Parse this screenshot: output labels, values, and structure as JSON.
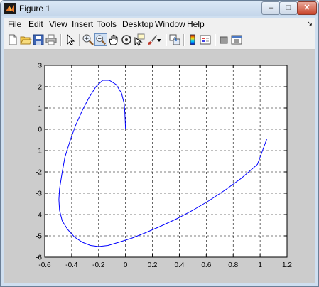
{
  "window": {
    "title": "Figure 1",
    "close_glyph": "✕",
    "minimize_glyph": "–",
    "maximize_glyph": "□"
  },
  "menu": {
    "items": [
      {
        "label": "File",
        "key": "F",
        "rest": "ile"
      },
      {
        "label": "Edit",
        "key": "E",
        "rest": "dit"
      },
      {
        "label": "View",
        "key": "V",
        "rest": "iew"
      },
      {
        "label": "Insert",
        "key": "I",
        "rest": "nsert"
      },
      {
        "label": "Tools",
        "key": "T",
        "rest": "ools"
      },
      {
        "label": "Desktop",
        "key": "D",
        "rest": "esktop"
      },
      {
        "label": "Window",
        "key": "W",
        "rest": "indow"
      },
      {
        "label": "Help",
        "key": "H",
        "rest": "elp"
      }
    ],
    "dock_glyph": "↘"
  },
  "toolbar": {
    "buttons": [
      "new-figure",
      "open-file",
      "save-figure",
      "print-figure",
      "edit-plot",
      "zoom-in",
      "zoom-out",
      "pan",
      "rotate-3d",
      "data-cursor",
      "brush",
      "link-plot",
      "insert-colorbar",
      "insert-legend",
      "hide-plot-tools",
      "show-plot-tools"
    ],
    "active": "zoom-out"
  },
  "colors": {
    "line": "#0000ff",
    "axes_bg": "#ffffff",
    "figure_bg": "#cccccc"
  },
  "chart_data": {
    "type": "line",
    "title": "",
    "xlabel": "",
    "ylabel": "",
    "xlim": [
      -0.6,
      1.2
    ],
    "ylim": [
      -6,
      3
    ],
    "xticks": [
      -0.6,
      -0.4,
      -0.2,
      0,
      0.2,
      0.4,
      0.6,
      0.8,
      1,
      1.2
    ],
    "yticks": [
      -6,
      -5,
      -4,
      -3,
      -2,
      -1,
      0,
      1,
      2,
      3
    ],
    "xtick_labels": [
      "-0.6",
      "-0.4",
      "-0.2",
      "0",
      "0.2",
      "0.4",
      "0.6",
      "0.8",
      "1",
      "1.2"
    ],
    "ytick_labels": [
      "-6",
      "-5",
      "-4",
      "-3",
      "-2",
      "-1",
      "0",
      "1",
      "2",
      "3"
    ],
    "grid": true,
    "grid_style": "dashed",
    "series": [
      {
        "x": [
          0.0,
          -0.005,
          -0.01,
          -0.03,
          -0.07,
          -0.12,
          -0.17,
          -0.22,
          -0.27,
          -0.32,
          -0.37,
          -0.41,
          -0.45,
          -0.47,
          -0.49,
          -0.495,
          -0.49,
          -0.47,
          -0.43,
          -0.38,
          -0.32,
          -0.26,
          -0.2,
          -0.13,
          -0.05,
          0.05,
          0.15,
          0.26,
          0.38,
          0.5,
          0.62,
          0.74,
          0.86,
          0.98,
          1.05
        ],
        "y": [
          0.0,
          0.8,
          1.2,
          1.7,
          2.1,
          2.3,
          2.3,
          2.0,
          1.5,
          0.9,
          0.2,
          -0.5,
          -1.3,
          -2.0,
          -2.8,
          -3.3,
          -3.8,
          -4.3,
          -4.7,
          -5.05,
          -5.3,
          -5.45,
          -5.5,
          -5.45,
          -5.3,
          -5.1,
          -4.85,
          -4.55,
          -4.2,
          -3.8,
          -3.35,
          -2.85,
          -2.3,
          -1.65,
          -0.45
        ]
      }
    ]
  }
}
